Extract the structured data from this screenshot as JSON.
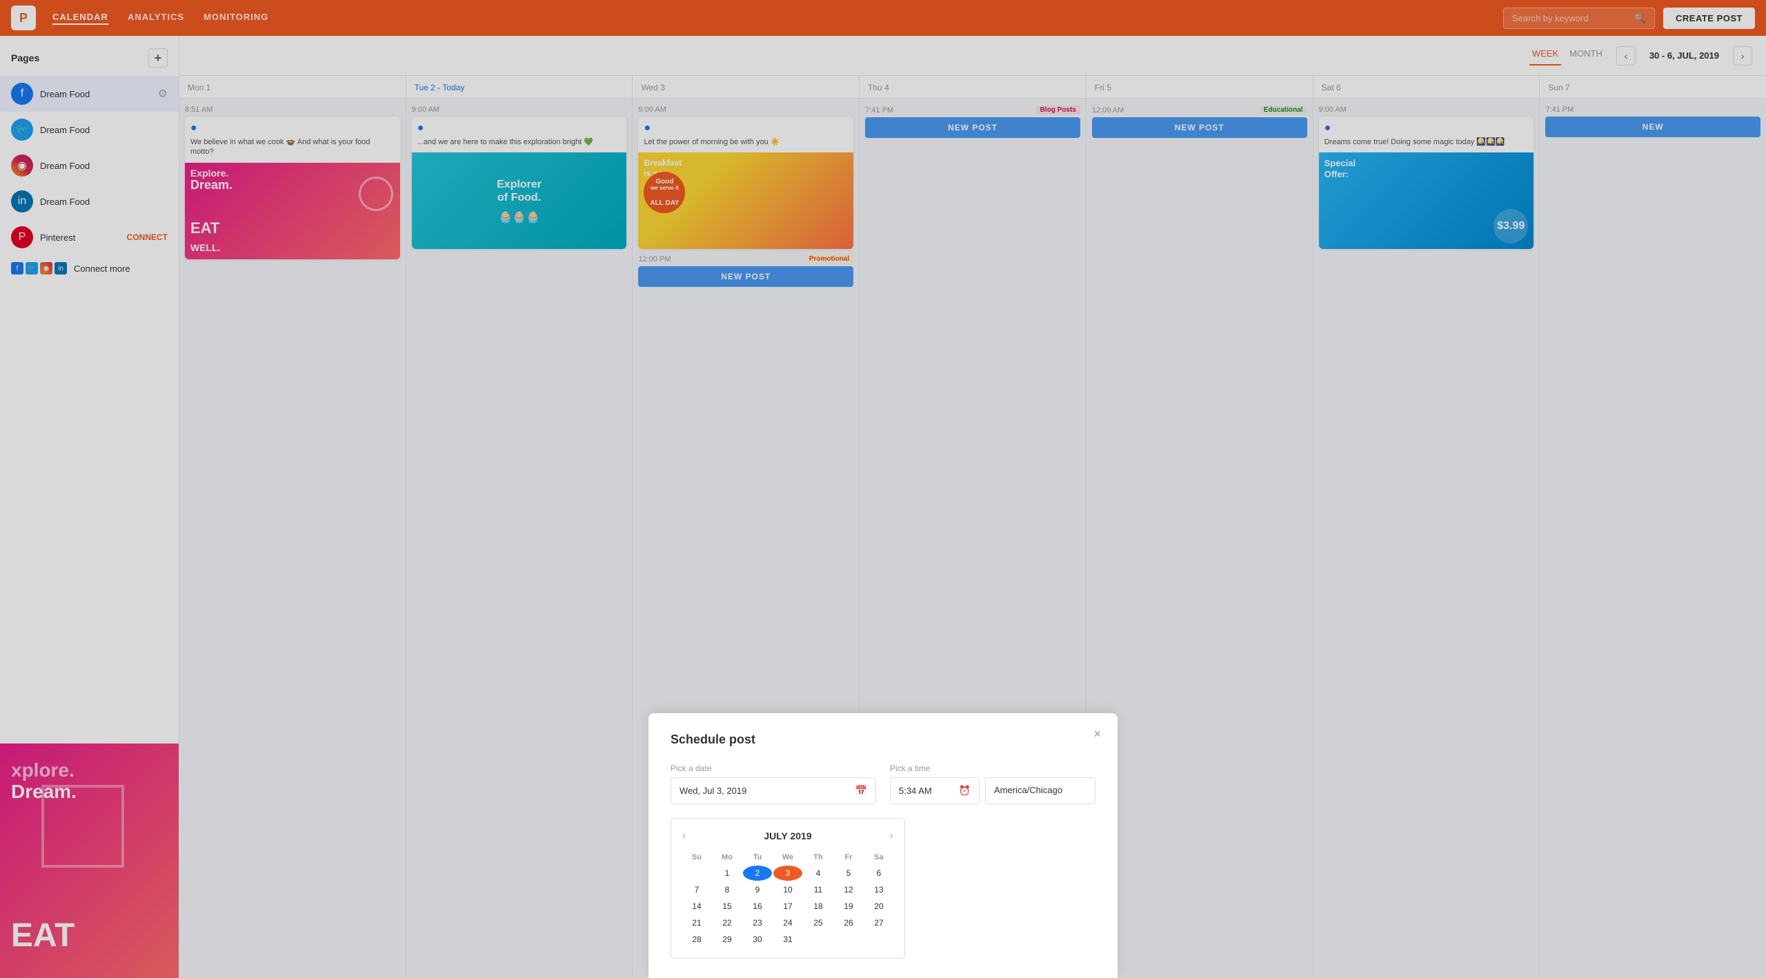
{
  "topnav": {
    "logo": "P",
    "links": [
      "CALENDAR",
      "ANALYTICS",
      "MONITORING"
    ],
    "active_link": "CALENDAR",
    "search_placeholder": "Search by keyword",
    "create_btn": "CREATE POST"
  },
  "sidebar": {
    "title": "Pages",
    "pages": [
      {
        "name": "Dream Food",
        "type": "facebook",
        "active": true
      },
      {
        "name": "Dream Food",
        "type": "twitter",
        "active": false
      },
      {
        "name": "Dream Food",
        "type": "instagram",
        "active": false
      },
      {
        "name": "Dream Food",
        "type": "linkedin",
        "active": false
      },
      {
        "name": "Pinterest",
        "type": "pinterest",
        "active": false,
        "connect": "CONNECT"
      }
    ],
    "connect_more_label": "Connect more"
  },
  "calendar": {
    "views": [
      "WEEK",
      "MONTH"
    ],
    "active_view": "WEEK",
    "range": "30 - 6, JUL, 2019",
    "days": [
      {
        "label": "Mon 1",
        "today": false
      },
      {
        "label": "Tue 2 - Today",
        "today": true
      },
      {
        "label": "Wed 3",
        "today": false
      },
      {
        "label": "Thu 4",
        "today": false
      },
      {
        "label": "Fri 5",
        "today": false
      },
      {
        "label": "Sat 6",
        "today": false
      },
      {
        "label": "Sun 7",
        "today": false
      }
    ],
    "posts": {
      "mon": {
        "time": "8:51 AM",
        "text": "We believe in what we cook 🍲 And what is your food motto?",
        "card_type": "explore"
      },
      "tue": {
        "time": "9:00 AM",
        "text": "...and we are here to make this exploration bright 💚",
        "card_type": "teal"
      },
      "wed_1": {
        "time": "9:00 AM",
        "text": "Let the power of morning be with you ☀️",
        "card_type": "breakfast"
      },
      "wed_2": {
        "time": "12:00 PM",
        "tag": "Promotional",
        "new_post_btn": "NEW POST"
      },
      "thu": {
        "time": "7:41 PM",
        "tag": "Blog Posts",
        "new_post_btn": "NEW POST"
      },
      "fri": {
        "time": "12:00 AM",
        "tag": "Educational",
        "new_post_btn": "NEW POST"
      },
      "sat": {
        "time": "9:00 AM",
        "text": "Dreams come true!\nDoing some magic today 🎑🎑🎑",
        "card_type": "special"
      },
      "sun": {
        "time": "7:41 PM",
        "new_post_btn": "NEW"
      }
    }
  },
  "modal": {
    "title": "Schedule post",
    "close": "×",
    "date_label": "Pick a date",
    "date_value": "Wed, Jul 3, 2019",
    "time_label": "Pick a time",
    "time_value": "5:34 AM",
    "timezone_value": "America/Chicago",
    "mini_cal_title": "JULY 2019",
    "mini_cal_days_header": [
      "Su",
      "Mo",
      "Tu",
      "We",
      "Th",
      "Fr",
      "Sa"
    ],
    "mini_cal_cells": [
      "",
      "1",
      "2",
      "3",
      "4",
      "5",
      "6",
      "7",
      "8",
      "9",
      "10",
      "11",
      "12",
      "13",
      "14",
      "15",
      "16",
      "17",
      "18",
      "19",
      "20",
      "21",
      "22",
      "23",
      "24",
      "25",
      "26",
      "27",
      "28",
      "29",
      "30",
      "31",
      "",
      "",
      ""
    ]
  }
}
